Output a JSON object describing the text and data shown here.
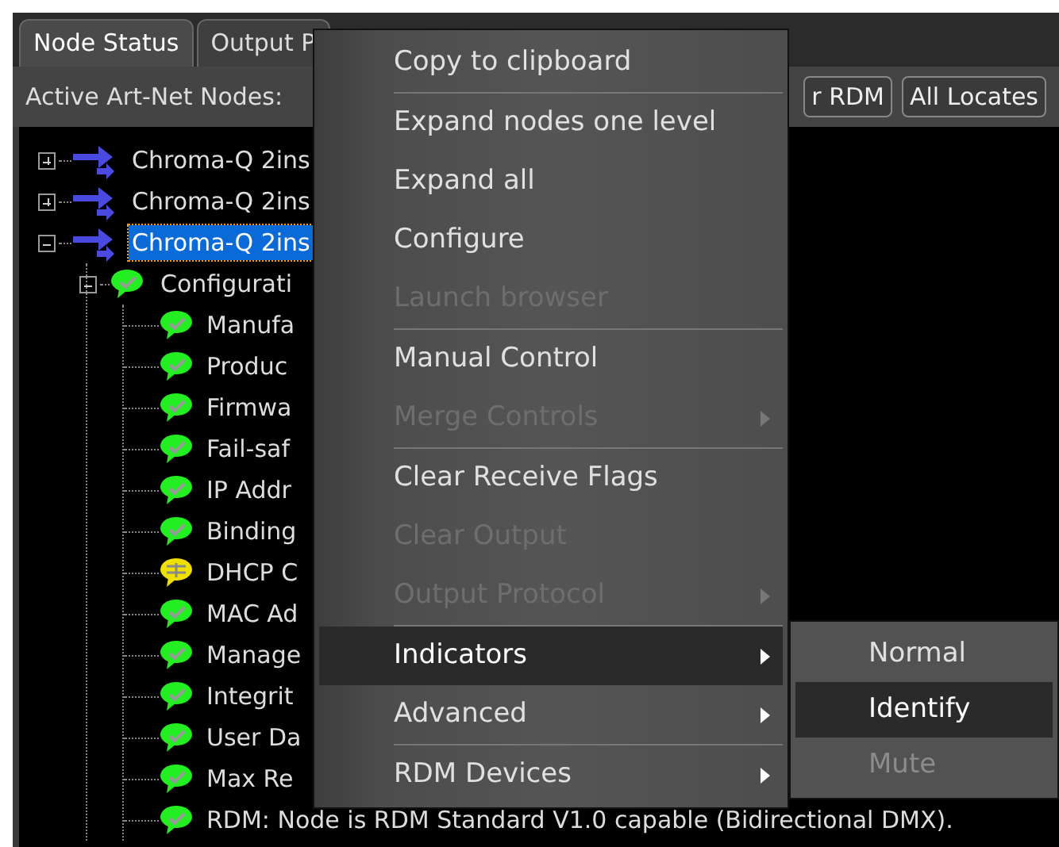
{
  "tabs": [
    {
      "label": "Node Status",
      "selected": true
    },
    {
      "label": "Output P",
      "selected": false
    }
  ],
  "toolbar": {
    "label": "Active Art-Net Nodes:",
    "buttons": [
      "r RDM",
      "All Locates"
    ]
  },
  "tree": [
    {
      "label": "Chroma-Q 2ins",
      "expanded": false,
      "selected": false
    },
    {
      "label": "Chroma-Q 2ins",
      "expanded": false,
      "selected": false
    },
    {
      "label": "Chroma-Q 2ins",
      "expanded": true,
      "selected": true,
      "children": [
        {
          "label": "Configurati",
          "expanded": true,
          "kind": "ok",
          "children": [
            {
              "label": "Manufa",
              "kind": "ok"
            },
            {
              "label": "Produc",
              "kind": "ok"
            },
            {
              "label": "Firmwa",
              "kind": "ok"
            },
            {
              "label": "Fail-saf",
              "kind": "ok"
            },
            {
              "label": "IP Addr",
              "kind": "ok"
            },
            {
              "label": "Binding",
              "kind": "ok"
            },
            {
              "label": "DHCP C",
              "kind": "warning"
            },
            {
              "label": "MAC Ad",
              "kind": "ok"
            },
            {
              "label": "Manage",
              "kind": "ok"
            },
            {
              "label": "Integrit",
              "kind": "ok"
            },
            {
              "label": "User Da",
              "kind": "ok"
            },
            {
              "label": "Max Re",
              "kind": "ok"
            },
            {
              "label": "RDM: Node is RDM Standard V1.0 capable (Bidirectional DMX).",
              "kind": "ok"
            }
          ]
        }
      ]
    }
  ],
  "context_menu": [
    {
      "kind": "item",
      "label": "Copy to clipboard",
      "disabled": false,
      "submenu": false,
      "selected": false
    },
    {
      "kind": "separator"
    },
    {
      "kind": "item",
      "label": "Expand nodes one level",
      "disabled": false,
      "submenu": false,
      "selected": false
    },
    {
      "kind": "item",
      "label": "Expand all",
      "disabled": false,
      "submenu": false,
      "selected": false
    },
    {
      "kind": "item",
      "label": "Configure",
      "disabled": false,
      "submenu": false,
      "selected": false
    },
    {
      "kind": "item",
      "label": "Launch browser",
      "disabled": true,
      "submenu": false,
      "selected": false
    },
    {
      "kind": "separator"
    },
    {
      "kind": "item",
      "label": "Manual Control",
      "disabled": false,
      "submenu": false,
      "selected": false
    },
    {
      "kind": "item",
      "label": "Merge Controls",
      "disabled": true,
      "submenu": true,
      "selected": false
    },
    {
      "kind": "separator"
    },
    {
      "kind": "item",
      "label": "Clear Receive Flags",
      "disabled": false,
      "submenu": false,
      "selected": false
    },
    {
      "kind": "item",
      "label": "Clear Output",
      "disabled": true,
      "submenu": false,
      "selected": false
    },
    {
      "kind": "item",
      "label": "Output Protocol",
      "disabled": true,
      "submenu": true,
      "selected": false
    },
    {
      "kind": "separator"
    },
    {
      "kind": "item",
      "label": "Indicators",
      "disabled": false,
      "submenu": true,
      "selected": true
    },
    {
      "kind": "item",
      "label": "Advanced",
      "disabled": false,
      "submenu": true,
      "selected": false
    },
    {
      "kind": "separator"
    },
    {
      "kind": "item",
      "label": "RDM Devices",
      "disabled": false,
      "submenu": true,
      "selected": false
    }
  ],
  "submenu": [
    {
      "label": "Normal",
      "disabled": false,
      "selected": false
    },
    {
      "label": "Identify",
      "disabled": false,
      "selected": true
    },
    {
      "label": "Mute",
      "disabled": true,
      "selected": false
    }
  ]
}
